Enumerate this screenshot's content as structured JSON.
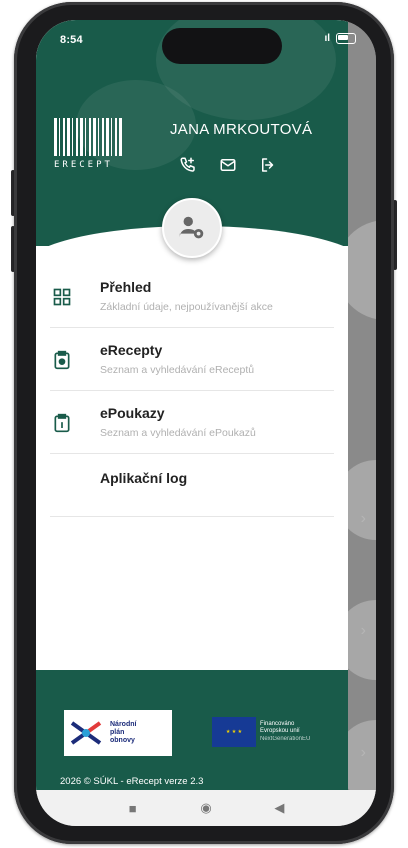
{
  "status_bar": {
    "time": "8:54",
    "signal": "↗ıl"
  },
  "header": {
    "logo_text": "ERECEPT",
    "user_name": "JANA MRKOUTOVÁ",
    "actions": [
      "phone-icon",
      "mail-icon",
      "logout-icon"
    ]
  },
  "menu": {
    "items": [
      {
        "icon": "dashboard-icon",
        "title": "Přehled",
        "subtitle": "Základní údaje, nejpoužívanější akce"
      },
      {
        "icon": "prescription-icon",
        "title": "eRecepty",
        "subtitle": "Seznam a vyhledávání eReceptů"
      },
      {
        "icon": "voucher-icon",
        "title": "ePoukazy",
        "subtitle": "Seznam a vyhledávání ePoukazů"
      },
      {
        "icon": "",
        "title": "Aplikační log",
        "subtitle": ""
      }
    ]
  },
  "footer": {
    "npo_text": [
      "Národní",
      "plán",
      "obnovy"
    ],
    "eu_text": [
      "Financováno",
      "Evropskou unií",
      "NextGenerationEU"
    ],
    "copyright": "2026 © SÚKL - eRecept verze 2.3"
  },
  "colors": {
    "primary": "#195b4a",
    "backdrop": "#8a8a8a"
  }
}
